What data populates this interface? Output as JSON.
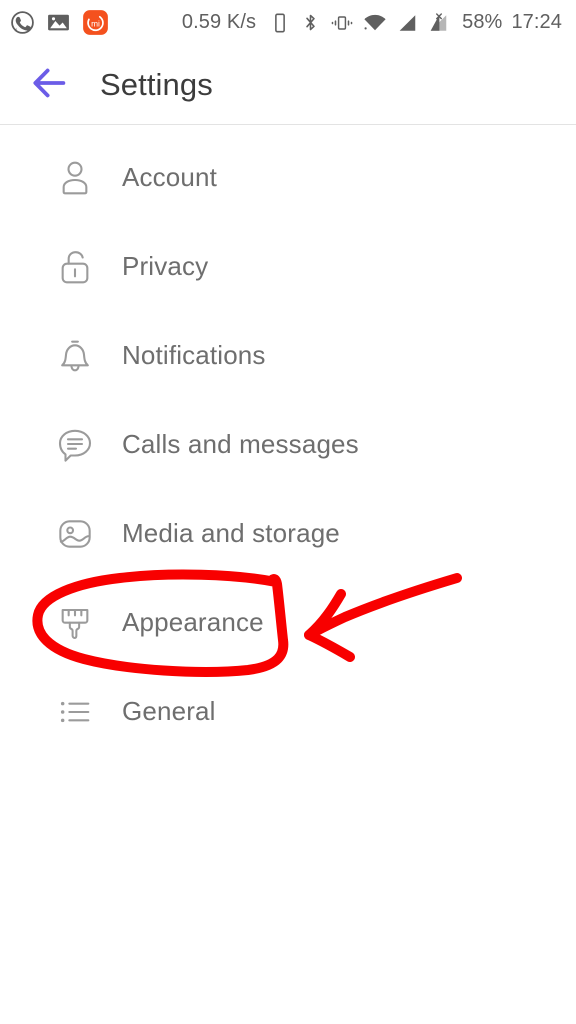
{
  "status_bar": {
    "left_icons": [
      {
        "name": "whatsapp-icon",
        "label": "WhatsApp"
      },
      {
        "name": "gallery-icon",
        "label": "Gallery"
      },
      {
        "name": "mi-app-icon",
        "label": "mi"
      }
    ],
    "network_speed": "0.59 K/s",
    "right_icons": [
      {
        "name": "phone-icon",
        "label": "Phone"
      },
      {
        "name": "bluetooth-icon",
        "label": "Bluetooth"
      },
      {
        "name": "vibrate-icon",
        "label": "Vibrate"
      },
      {
        "name": "wifi-icon",
        "label": "Wi-Fi"
      },
      {
        "name": "signal-bars-icon",
        "label": "Signal"
      },
      {
        "name": "signal-no-sim-icon",
        "label": "No SIM"
      }
    ],
    "battery_percent": "58%",
    "clock": "17:24",
    "text_color": "#5f5f5f"
  },
  "header": {
    "back_icon": "arrow-left-icon",
    "back_color": "#6b5ce7",
    "title": "Settings",
    "title_color": "#3c3c3c"
  },
  "settings_list": {
    "icon_color": "#9b9b9b",
    "label_color": "#6e6e6e",
    "items": [
      {
        "label": "Account",
        "icon": "person-icon"
      },
      {
        "label": "Privacy",
        "icon": "unlocked-padlock-icon"
      },
      {
        "label": "Notifications",
        "icon": "bell-icon"
      },
      {
        "label": "Calls and messages",
        "icon": "chat-bubble-icon"
      },
      {
        "label": "Media and storage",
        "icon": "image-icon"
      },
      {
        "label": "Appearance",
        "icon": "paintbrush-icon"
      },
      {
        "label": "General",
        "icon": "bulleted-list-icon"
      }
    ]
  },
  "annotations": {
    "color": "#f80000",
    "ellipse": {
      "name": "highlight-ellipse",
      "target": "Appearance"
    },
    "arrow": {
      "name": "pointer-arrow",
      "target": "Appearance",
      "direction": "left"
    }
  }
}
